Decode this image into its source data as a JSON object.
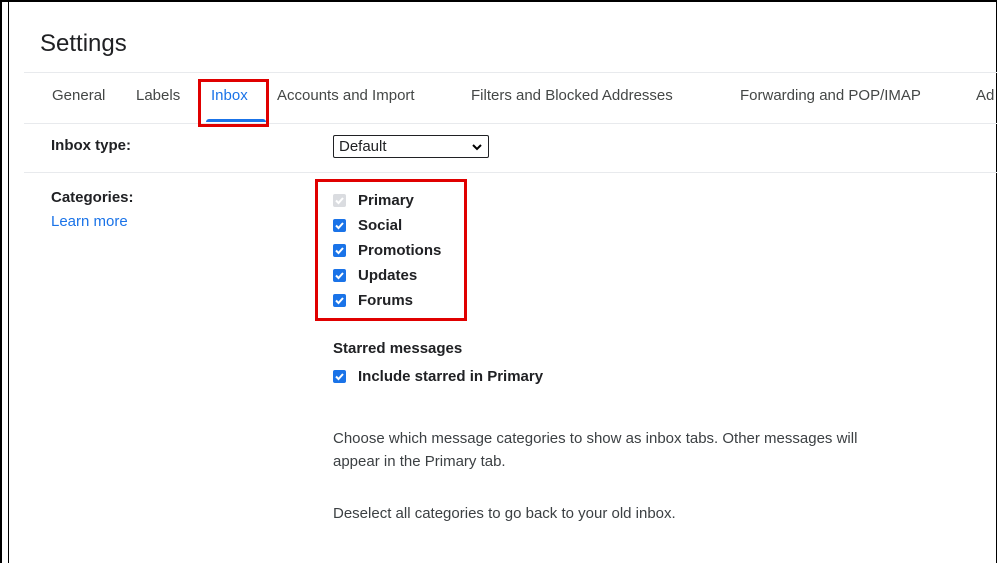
{
  "page": {
    "title": "Settings"
  },
  "tabs": [
    {
      "label": "General"
    },
    {
      "label": "Labels"
    },
    {
      "label": "Inbox"
    },
    {
      "label": "Accounts and Import"
    },
    {
      "label": "Filters and Blocked Addresses"
    },
    {
      "label": "Forwarding and POP/IMAP"
    },
    {
      "label": "Ad"
    }
  ],
  "active_tab": "Inbox",
  "inbox_type": {
    "label": "Inbox type:",
    "selected": "Default"
  },
  "categories": {
    "label": "Categories:",
    "learn_more": "Learn more",
    "items": [
      {
        "label": "Primary",
        "checked": true,
        "disabled": true
      },
      {
        "label": "Social",
        "checked": true,
        "disabled": false
      },
      {
        "label": "Promotions",
        "checked": true,
        "disabled": false
      },
      {
        "label": "Updates",
        "checked": true,
        "disabled": false
      },
      {
        "label": "Forums",
        "checked": true,
        "disabled": false
      }
    ]
  },
  "starred": {
    "heading": "Starred messages",
    "option": "Include starred in Primary",
    "checked": true
  },
  "description": {
    "line1": "Choose which message categories to show as inbox tabs. Other messages will",
    "line2": "appear in the Primary tab.",
    "line3": "Deselect all categories to go back to your old inbox."
  },
  "colors": {
    "accent": "#1a73e8",
    "highlight_box": "#e00000"
  }
}
